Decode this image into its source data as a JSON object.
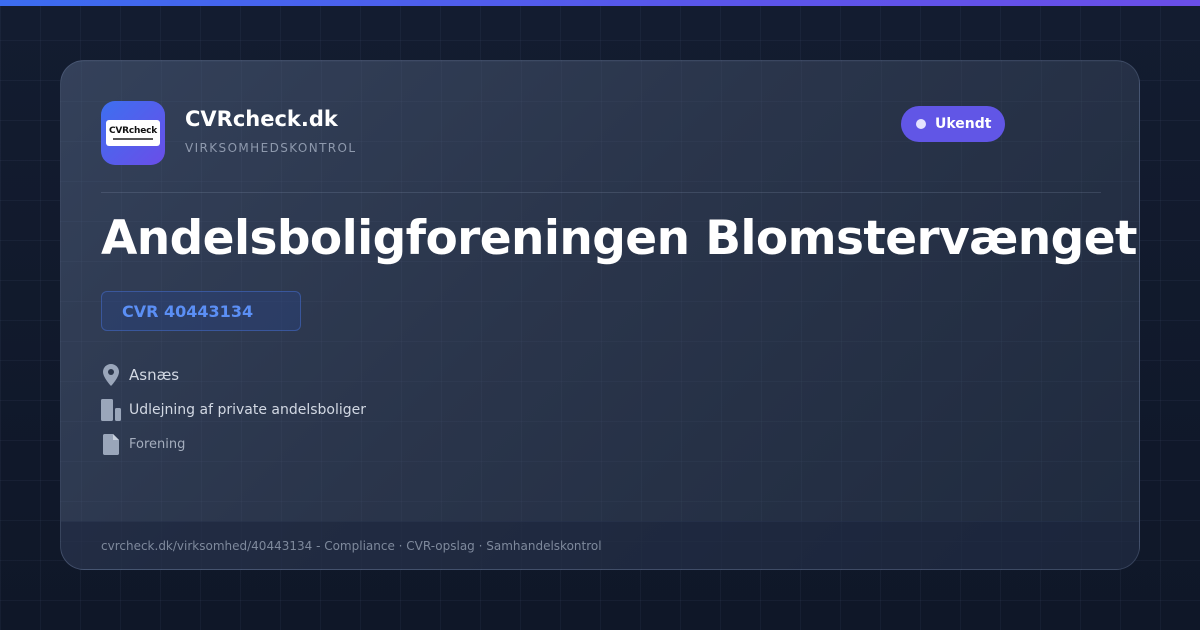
{
  "brand": {
    "name": "CVRcheck.dk",
    "tagline": "VIRKSOMHEDSKONTROL",
    "logo_text": "CVRcheck",
    "accent_color": "#6156e6"
  },
  "status": {
    "label": "Ukendt",
    "color": "#6156e6"
  },
  "company": {
    "name": "Andelsboligforeningen Blomstervænget III",
    "cvr": "CVR 40443134"
  },
  "details": {
    "location": {
      "icon": "location-pin-icon",
      "text": "Asnæs"
    },
    "industry": {
      "icon": "building-icon",
      "text": "Udlejning af private andelsboliger"
    },
    "company_type": {
      "icon": "document-icon",
      "text": "Forening"
    }
  },
  "footer": {
    "text": "cvrcheck.dk/virksomhed/40443134 - Compliance · CVR-opslag · Samhandelskontrol"
  }
}
